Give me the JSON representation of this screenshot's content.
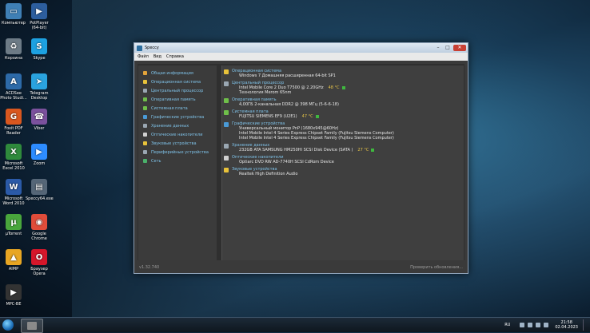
{
  "desktop": {
    "icons_left": [
      {
        "label": "Компьютер",
        "icon": "computer-icon",
        "color": "#3f7fb5",
        "glyph": "▭"
      },
      {
        "label": "Корзина",
        "icon": "recycle-bin-icon",
        "color": "#6d7b86",
        "glyph": "♻"
      },
      {
        "label": "ACDSee Photo Studi...",
        "icon": "acdsee-icon",
        "color": "#2d6aa8",
        "glyph": "A"
      },
      {
        "label": "Foxit PDF Reader",
        "icon": "foxit-icon",
        "color": "#d9571f",
        "glyph": "G"
      },
      {
        "label": "Microsoft Excel 2010",
        "icon": "excel-icon",
        "color": "#2f8a3c",
        "glyph": "X"
      },
      {
        "label": "Microsoft Word 2010",
        "icon": "word-icon",
        "color": "#2b5aa8",
        "glyph": "W"
      },
      {
        "label": "µTorrent",
        "icon": "utorrent-icon",
        "color": "#49a63c",
        "glyph": "µ"
      },
      {
        "label": "AIMP",
        "icon": "aimp-icon",
        "color": "#e8a623",
        "glyph": "▲"
      },
      {
        "label": "MPC-BE",
        "icon": "mpc-be-icon",
        "color": "#333333",
        "glyph": "▶"
      }
    ],
    "icons_right": [
      {
        "label": "PotPlayer (64-bit)",
        "icon": "potplayer-icon",
        "color": "#2d5e9e",
        "glyph": "▶"
      },
      {
        "label": "Skype",
        "icon": "skype-icon",
        "color": "#1da1e1",
        "glyph": "S"
      },
      {
        "label": "Telegram Desktop",
        "icon": "telegram-icon",
        "color": "#2aa3df",
        "glyph": "➤"
      },
      {
        "label": "Viber",
        "icon": "viber-icon",
        "color": "#7b519d",
        "glyph": "☎"
      },
      {
        "label": "Zoom",
        "icon": "zoom-icon",
        "color": "#2d8cff",
        "glyph": "▶"
      },
      {
        "label": "Speccy64.exe",
        "icon": "speccy-icon",
        "color": "#556677",
        "glyph": "▤"
      },
      {
        "label": "Google Chrome",
        "icon": "chrome-icon",
        "color": "#e04c3a",
        "glyph": "◉"
      },
      {
        "label": "Браузер Opera",
        "icon": "opera-icon",
        "color": "#d5162a",
        "glyph": "O"
      }
    ]
  },
  "window": {
    "title": "Speccy",
    "menu": [
      "Файл",
      "Вид",
      "Справка"
    ],
    "sidebar": [
      {
        "label": "Общая информация",
        "color": "#e3a33a"
      },
      {
        "label": "Операционная система",
        "color": "#e8c23a"
      },
      {
        "label": "Центральный процессор",
        "color": "#9aa7b2"
      },
      {
        "label": "Оперативная память",
        "color": "#6fbf4a"
      },
      {
        "label": "Системная плата",
        "color": "#6fbf4a"
      },
      {
        "label": "Графические устройства",
        "color": "#4a9ad6"
      },
      {
        "label": "Хранение данных",
        "color": "#9aa7b2"
      },
      {
        "label": "Оптические накопители",
        "color": "#d0d0d0"
      },
      {
        "label": "Звуковые устройства",
        "color": "#e8c23a"
      },
      {
        "label": "Периферийные устройства",
        "color": "#9aa7b2"
      },
      {
        "label": "Сеть",
        "color": "#4ab06a"
      }
    ],
    "sections": [
      {
        "title": "Операционная система",
        "color": "#e8c23a",
        "lines": [
          "Windows 7 Домашняя расширенная 64-bit SP1"
        ]
      },
      {
        "title": "Центральный процессор",
        "color": "#9aa7b2",
        "lines": [
          "Intel Mobile Core 2 Duo T7500 @ 2.20GHz",
          "Технология Merom 65nm"
        ],
        "temp": "48 °C"
      },
      {
        "title": "Оперативная память",
        "color": "#6fbf4a",
        "lines": [
          "4,00ГБ 2-канальная DDR2 @ 398 МГц (5-6-6-18)"
        ]
      },
      {
        "title": "Системная плата",
        "color": "#6fbf4a",
        "lines": [
          "FUJITSU SIEMENS EF9 (U2E1)"
        ],
        "temp": "47 °C"
      },
      {
        "title": "Графические устройства",
        "color": "#4a9ad6",
        "lines": [
          "Универсальный монитор PnP (1680x945@60Hz)",
          "Intel Mobile Intel 4 Series Express Chipset Family (Fujitsu Siemens Computer)",
          "Intel Mobile Intel 4 Series Express Chipset Family (Fujitsu Siemens Computer)"
        ]
      },
      {
        "title": "Хранение данных",
        "color": "#9aa7b2",
        "lines": [
          "232GB ATA SAMSUNG HM250HI SCSI Disk Device (SATA )"
        ],
        "temp": "27 °C"
      },
      {
        "title": "Оптические накопители",
        "color": "#d0d0d0",
        "lines": [
          "Optiarc DVD RW AD-7740H SCSI CdRom Device"
        ]
      },
      {
        "title": "Звуковые устройства",
        "color": "#e8c23a",
        "lines": [
          "Realtek High Definition Audio"
        ]
      }
    ],
    "version": "v1.32.740",
    "check_updates": "Проверить обновления..."
  },
  "taskbar": {
    "lang": "RU",
    "time": "21:58",
    "date": "02.04.2023"
  }
}
